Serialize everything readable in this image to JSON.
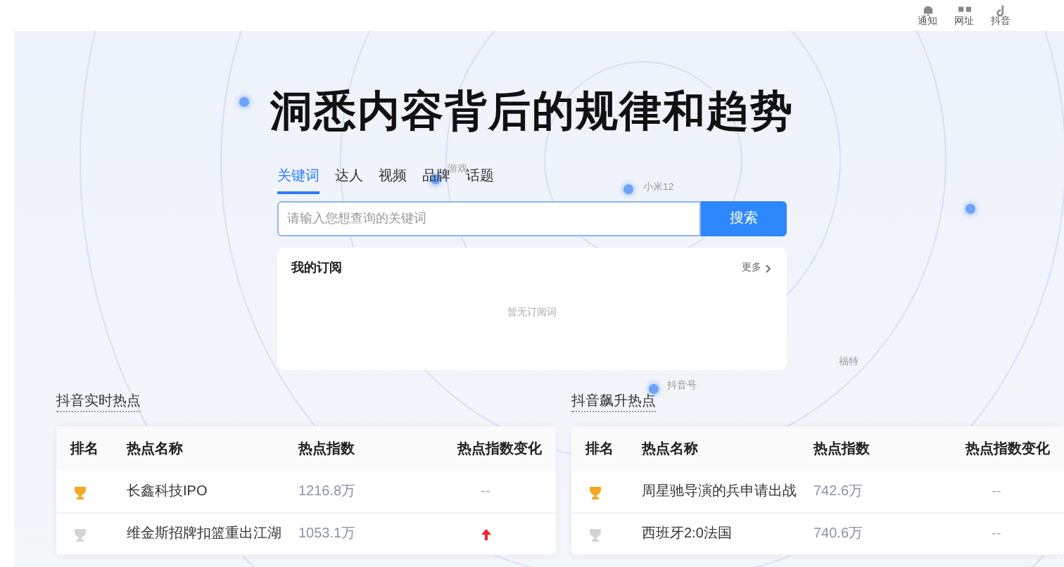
{
  "top_nav": [
    {
      "label": "通知"
    },
    {
      "label": "网址"
    },
    {
      "label": "抖音"
    }
  ],
  "headline": "洞悉内容背后的规律和趋势",
  "floating_tags": [
    {
      "label": "游戏"
    },
    {
      "label": "小米12"
    },
    {
      "label": "福特"
    },
    {
      "label": "抖音号"
    }
  ],
  "search_tabs": [
    {
      "label": "关键词",
      "selected": true
    },
    {
      "label": "达人",
      "selected": false
    },
    {
      "label": "视频",
      "selected": false
    },
    {
      "label": "品牌",
      "selected": false
    },
    {
      "label": "话题",
      "selected": false
    }
  ],
  "search": {
    "placeholder": "请输入您想查询的关键词",
    "button": "搜索"
  },
  "subscriptions": {
    "title": "我的订阅",
    "more": "更多",
    "empty": "暂无订阅词"
  },
  "boards": [
    {
      "title": "抖音实时热点",
      "columns": [
        "排名",
        "热点名称",
        "热点指数",
        "热点指数变化"
      ],
      "rows": [
        {
          "name": "长鑫科技IPO",
          "index": "1216.8万",
          "change": {
            "kind": "none",
            "text": "--"
          }
        },
        {
          "name": "维金斯招牌扣篮重出江湖",
          "index": "1053.1万",
          "change": {
            "kind": "up"
          }
        }
      ]
    },
    {
      "title": "抖音飙升热点",
      "columns": [
        "排名",
        "热点名称",
        "热点指数",
        "热点指数变化"
      ],
      "rows": [
        {
          "name": "周星驰导演的兵申请出战",
          "index": "742.6万",
          "change": {
            "kind": "none",
            "text": "--"
          }
        },
        {
          "name": "西班牙2:0法国",
          "index": "740.6万",
          "change": {
            "kind": "none",
            "text": "--"
          }
        }
      ]
    }
  ]
}
